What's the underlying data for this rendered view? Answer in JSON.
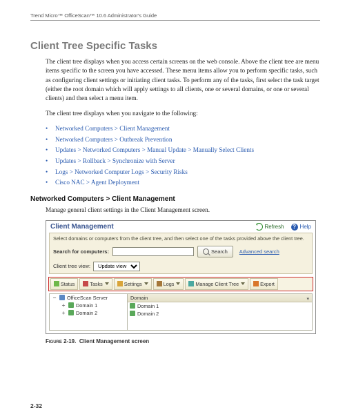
{
  "running_head": "Trend Micro™ OfficeScan™ 10.6 Administrator's Guide",
  "section_title": "Client Tree Specific Tasks",
  "para1": "The client tree displays when you access certain screens on the web console. Above the client tree are menu items specific to the screen you have accessed. These menu items allow you to perform specific tasks, such as configuring client settings or initiating client tasks. To perform any of the tasks, first select the task target (either the root domain which will apply settings to all clients, one or several domains, or one or several clients) and then select a menu item.",
  "para2": "The client tree displays when you navigate to the following:",
  "links": [
    "Networked Computers > Client Management",
    "Networked Computers > Outbreak Prevention",
    "Updates > Networked Computers > Manual Update > Manually Select Clients",
    "Updates > Rollback > Synchronize with Server",
    "Logs > Networked Computer Logs > Security Risks",
    "Cisco NAC > Agent Deployment"
  ],
  "subhead": "Networked Computers > Client Management",
  "para3": "Manage general client settings in the Client Management screen.",
  "figure": {
    "title": "Client Management",
    "refresh": "Refresh",
    "help": "Help",
    "hint": "Select domains or computers from the client tree, and then select one of the tasks provided above the client tree.",
    "search_label": "Search for computers:",
    "search_btn": "Search",
    "advanced": "Advanced search",
    "tree_label": "Client tree view:",
    "tree_select": "Update view",
    "toolbar": [
      "Status",
      "Tasks",
      "Settings",
      "Logs",
      "Manage Client Tree",
      "Export"
    ],
    "left_head": "OfficeScan Server",
    "right_head": "Domain",
    "domains": [
      "Domain 1",
      "Domain 2"
    ]
  },
  "caption_num": "Figure 2-19.",
  "caption_text": "Client Management screen",
  "page_num": "2-32"
}
